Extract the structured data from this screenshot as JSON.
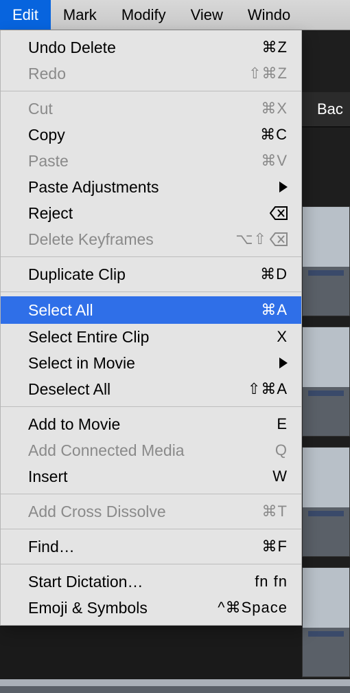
{
  "menubar": {
    "edit": "Edit",
    "mark": "Mark",
    "modify": "Modify",
    "view": "View",
    "window": "Windo"
  },
  "side": {
    "back_label": "Bac"
  },
  "menu": {
    "undo_delete": {
      "label": "Undo Delete",
      "shortcut": "⌘Z"
    },
    "redo": {
      "label": "Redo",
      "shortcut": "⇧⌘Z"
    },
    "cut": {
      "label": "Cut",
      "shortcut": "⌘X"
    },
    "copy": {
      "label": "Copy",
      "shortcut": "⌘C"
    },
    "paste": {
      "label": "Paste",
      "shortcut": "⌘V"
    },
    "paste_adjustments": {
      "label": "Paste Adjustments"
    },
    "reject": {
      "label": "Reject"
    },
    "delete_keyframes": {
      "label": "Delete Keyframes",
      "shortcut": "⌥⇧"
    },
    "duplicate_clip": {
      "label": "Duplicate Clip",
      "shortcut": "⌘D"
    },
    "select_all": {
      "label": "Select All",
      "shortcut": "⌘A"
    },
    "select_entire_clip": {
      "label": "Select Entire Clip",
      "shortcut": "X"
    },
    "select_in_movie": {
      "label": "Select in Movie"
    },
    "deselect_all": {
      "label": "Deselect All",
      "shortcut": "⇧⌘A"
    },
    "add_to_movie": {
      "label": "Add to Movie",
      "shortcut": "E"
    },
    "add_connected_media": {
      "label": "Add Connected Media",
      "shortcut": "Q"
    },
    "insert": {
      "label": "Insert",
      "shortcut": "W"
    },
    "add_cross_dissolve": {
      "label": "Add Cross Dissolve",
      "shortcut": "⌘T"
    },
    "find": {
      "label": "Find…",
      "shortcut": "⌘F"
    },
    "start_dictation": {
      "label": "Start Dictation…",
      "shortcut": "fn fn"
    },
    "emoji_symbols": {
      "label": "Emoji & Symbols",
      "shortcut": "^⌘Space"
    }
  }
}
